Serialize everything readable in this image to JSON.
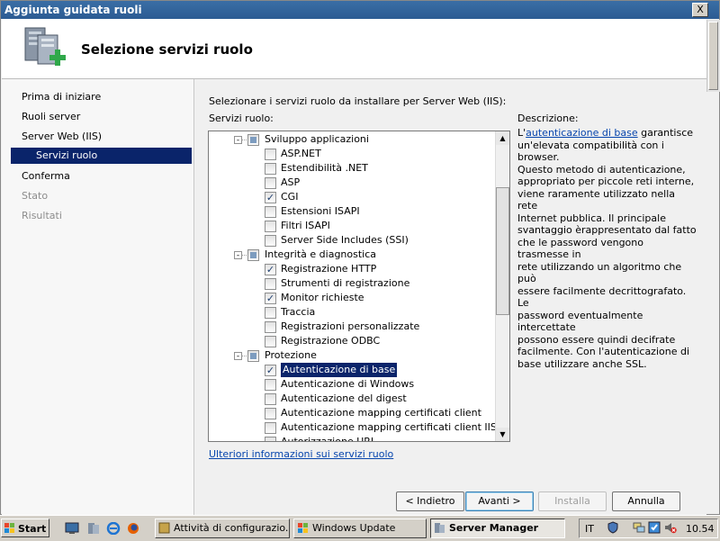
{
  "window": {
    "title": "Aggiunta guidata ruoli",
    "close_label": "X"
  },
  "header": {
    "title": "Selezione servizi ruolo"
  },
  "nav": {
    "items": [
      {
        "label": "Prima di iniziare",
        "state": "normal"
      },
      {
        "label": "Ruoli server",
        "state": "normal"
      },
      {
        "label": "Server Web (IIS)",
        "state": "normal"
      },
      {
        "label": "Servizi ruolo",
        "state": "active"
      },
      {
        "label": "Conferma",
        "state": "normal"
      },
      {
        "label": "Stato",
        "state": "disabled"
      },
      {
        "label": "Risultati",
        "state": "disabled"
      }
    ]
  },
  "main": {
    "instruction": "Selezionare i servizi ruolo da installare per Server Web (IIS):",
    "list_label": "Servizi ruolo:",
    "desc_label": "Descrizione:",
    "more_link": "Ulteriori informazioni sui servizi ruolo"
  },
  "services": [
    {
      "label": "Sviluppo applicazioni",
      "level": 0,
      "state": "partial",
      "expander": "-"
    },
    {
      "label": "ASP.NET",
      "level": 1,
      "state": "unchecked"
    },
    {
      "label": "Estendibilità .NET",
      "level": 1,
      "state": "unchecked"
    },
    {
      "label": "ASP",
      "level": 1,
      "state": "unchecked"
    },
    {
      "label": "CGI",
      "level": 1,
      "state": "checked"
    },
    {
      "label": "Estensioni ISAPI",
      "level": 1,
      "state": "unchecked"
    },
    {
      "label": "Filtri ISAPI",
      "level": 1,
      "state": "unchecked"
    },
    {
      "label": "Server Side Includes (SSI)",
      "level": 1,
      "state": "unchecked"
    },
    {
      "label": "Integrità e diagnostica",
      "level": 0,
      "state": "partial",
      "expander": "-"
    },
    {
      "label": "Registrazione HTTP",
      "level": 1,
      "state": "checked"
    },
    {
      "label": "Strumenti di registrazione",
      "level": 1,
      "state": "unchecked"
    },
    {
      "label": "Monitor richieste",
      "level": 1,
      "state": "checked"
    },
    {
      "label": "Traccia",
      "level": 1,
      "state": "unchecked"
    },
    {
      "label": "Registrazioni personalizzate",
      "level": 1,
      "state": "unchecked"
    },
    {
      "label": "Registrazione ODBC",
      "level": 1,
      "state": "unchecked"
    },
    {
      "label": "Protezione",
      "level": 0,
      "state": "partial",
      "expander": "-"
    },
    {
      "label": "Autenticazione di base",
      "level": 1,
      "state": "checked",
      "selected": true
    },
    {
      "label": "Autenticazione di Windows",
      "level": 1,
      "state": "unchecked"
    },
    {
      "label": "Autenticazione del digest",
      "level": 1,
      "state": "unchecked"
    },
    {
      "label": "Autenticazione mapping certificati client",
      "level": 1,
      "state": "unchecked"
    },
    {
      "label": "Autenticazione mapping certificati client IIS",
      "level": 1,
      "state": "unchecked"
    },
    {
      "label": "Autorizzazione URL",
      "level": 1,
      "state": "unchecked"
    }
  ],
  "description": {
    "prefix": "L'",
    "link": "autenticazione di base",
    "lines": [
      " garantisce",
      "un'elevata compatibilità con i browser.",
      "Questo metodo di autenticazione,",
      "appropriato per piccole reti interne,",
      "viene raramente utilizzato nella rete",
      "Internet pubblica. Il principale",
      "svantaggio èrappresentato dal fatto",
      "che le password vengono trasmesse in",
      "rete utilizzando un algoritmo che può",
      "essere facilmente decrittografato. Le",
      "password eventualmente intercettate",
      "possono essere quindi decifrate",
      "facilmente. Con l'autenticazione di",
      "base utilizzare anche SSL."
    ]
  },
  "buttons": {
    "back": "< Indietro",
    "next": "Avanti >",
    "install": "Installa",
    "cancel": "Annulla"
  },
  "taskbar": {
    "start": "Start",
    "tasks": [
      {
        "label": "Attività di configurazio...",
        "active": false
      },
      {
        "label": "Windows Update",
        "active": false
      },
      {
        "label": "Server Manager",
        "active": true
      }
    ],
    "lang": "IT",
    "clock": "10.54"
  },
  "colors": {
    "selection": "#0a246a",
    "link": "#0645ad",
    "titlebar": "#3a6ea5"
  }
}
